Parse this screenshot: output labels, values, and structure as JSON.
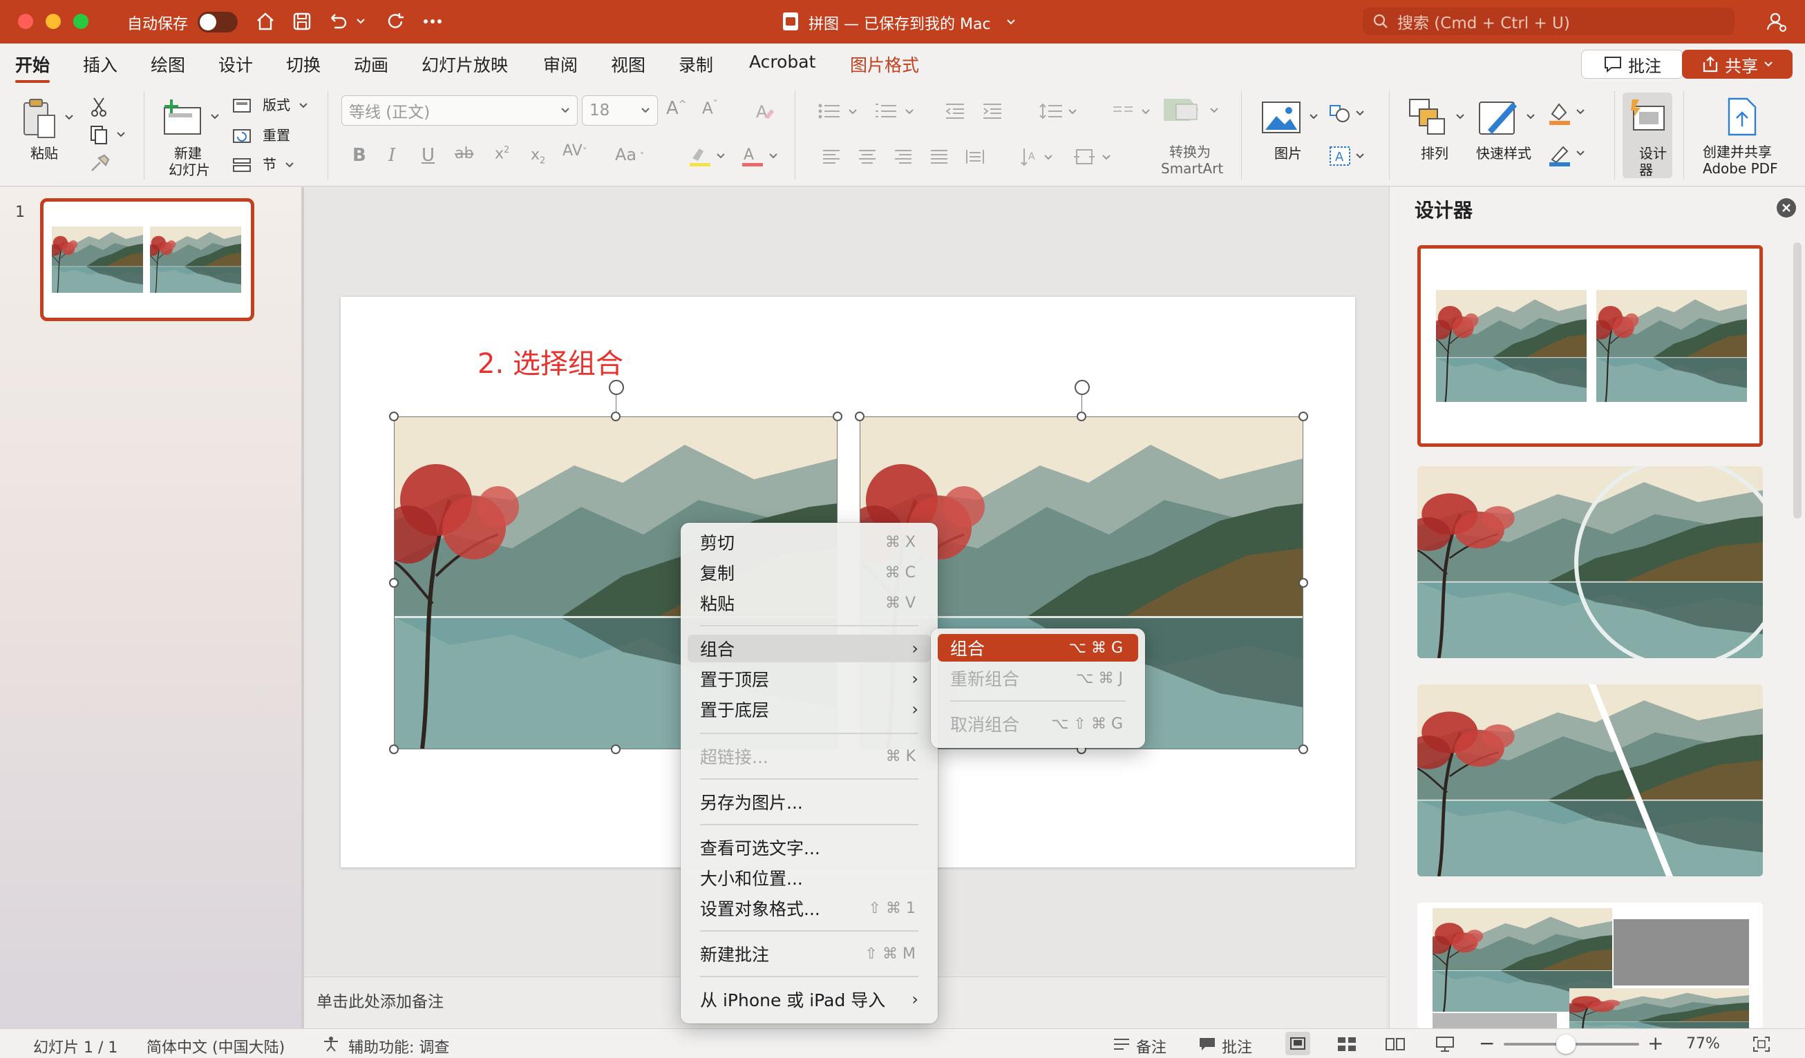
{
  "titlebar": {
    "autosave_label": "自动保存",
    "doc_title": "拼图 — 已保存到我的 Mac",
    "search_placeholder": "搜索 (Cmd + Ctrl + U)"
  },
  "tabs": [
    {
      "label": "开始",
      "active": true
    },
    {
      "label": "插入"
    },
    {
      "label": "绘图"
    },
    {
      "label": "设计"
    },
    {
      "label": "切换"
    },
    {
      "label": "动画"
    },
    {
      "label": "幻灯片放映"
    },
    {
      "label": "审阅"
    },
    {
      "label": "视图"
    },
    {
      "label": "录制"
    },
    {
      "label": "Acrobat"
    },
    {
      "label": "图片格式",
      "contextual": true
    }
  ],
  "header_buttons": {
    "comment": "批注",
    "share": "共享"
  },
  "ribbon": {
    "paste": "粘贴",
    "new_slide": "新建",
    "new_slide2": "幻灯片",
    "layout": "版式",
    "reset": "重置",
    "section": "节",
    "font_name": "等线 (正文)",
    "font_size": "18",
    "convert_smartart": "转换为",
    "convert_smartart2": "SmartArt",
    "picture": "图片",
    "arrange": "排列",
    "quick_styles": "快速样式",
    "designer": "设计",
    "designer2": "器",
    "create_pdf": "创建并共享",
    "create_pdf2": "Adobe PDF"
  },
  "slides_panel": {
    "slide_number": "1"
  },
  "slide": {
    "annotation": "2. 选择组合"
  },
  "context_menu": {
    "items": [
      {
        "label": "剪切",
        "shortcut": "⌘ X"
      },
      {
        "label": "复制",
        "shortcut": "⌘ C"
      },
      {
        "label": "粘贴",
        "shortcut": "⌘ V"
      },
      {
        "label": "组合",
        "submenu": true
      },
      {
        "label": "置于顶层",
        "submenu": true
      },
      {
        "label": "置于底层",
        "submenu": true
      },
      {
        "label": "超链接...",
        "shortcut": "⌘ K",
        "disabled": true
      },
      {
        "label": "另存为图片..."
      },
      {
        "label": "查看可选文字..."
      },
      {
        "label": "大小和位置..."
      },
      {
        "label": "设置对象格式...",
        "shortcut": "⇧ ⌘ 1"
      },
      {
        "label": "新建批注",
        "shortcut": "⇧ ⌘ M"
      },
      {
        "label": "从 iPhone 或 iPad 导入",
        "submenu": true
      }
    ]
  },
  "submenu": {
    "items": [
      {
        "label": "组合",
        "shortcut": "⌥ ⌘ G",
        "selected": true
      },
      {
        "label": "重新组合",
        "shortcut": "⌥ ⌘ J",
        "disabled": true
      },
      {
        "label": "取消组合",
        "shortcut": "⌥ ⇧ ⌘ G",
        "disabled": true
      }
    ]
  },
  "notes_placeholder": "单击此处添加备注",
  "designer": {
    "title": "设计器"
  },
  "status": {
    "slide_count": "幻灯片 1 / 1",
    "language": "简体中文 (中国大陆)",
    "accessibility": "辅助功能: 调查",
    "notes": "备注",
    "comments": "批注",
    "zoom": "77%"
  },
  "colors": {
    "accent": "#c3401f",
    "annotation_red": "#e8322e"
  }
}
